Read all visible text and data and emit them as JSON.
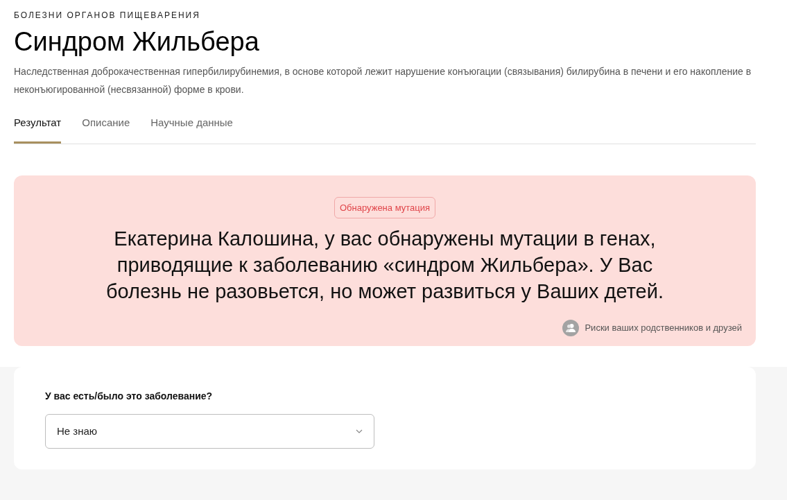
{
  "category": "БОЛЕЗНИ ОРГАНОВ ПИЩЕВАРЕНИЯ",
  "title": "Синдром Жильбера",
  "description": "Наследственная доброкачественная гипербилирубинемия, в основе которой лежит нарушение конъюгации (связывания) билирубина в печени и его накопление в неконъюгированной (несвязанной) форме в крови.",
  "tabs": [
    {
      "label": "Результат",
      "selected": true
    },
    {
      "label": "Описание",
      "selected": false
    },
    {
      "label": "Научные данные",
      "selected": false
    }
  ],
  "result": {
    "badge": "Обнаружена мутация",
    "message": "Екатерина Калошина, у вас обнаружены мутации в генах, приводящие к заболеванию «синдром Жильбера». У Вас болезнь не разовьется, но может развиться у Ваших детей.",
    "relatives_link": "Риски ваших родственников и друзей"
  },
  "question": {
    "label": "У вас есть/было это заболевание?",
    "value": "Не знаю"
  }
}
